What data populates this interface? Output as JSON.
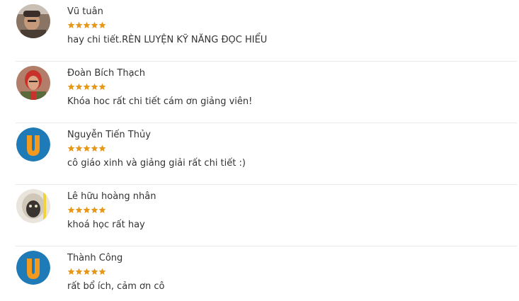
{
  "star_color": "#e59819",
  "reviews": [
    {
      "name": "Vũ tuân",
      "rating": 5,
      "text": "hay chi tiết.RÈN LUYỆN KỸ NĂNG ĐỌC HIỂU",
      "avatar": "photo"
    },
    {
      "name": "Đoàn Bích Thạch",
      "rating": 5,
      "text": "Khóa hoc rất chi tiết cám ơn giảng viên!",
      "avatar": "photo"
    },
    {
      "name": "Nguyễn Tiến Thủy",
      "rating": 5,
      "text": "cô giáo xinh và giảng giải rất chi tiết :)",
      "avatar": "letter",
      "avatar_letter": "U",
      "avatar_bg": "#1f7ab8",
      "avatar_fg": "#f39a1e"
    },
    {
      "name": "Lê hữu hoàng nhân",
      "rating": 5,
      "text": "khoá học rất hay",
      "avatar": "photo"
    },
    {
      "name": "Thành Công",
      "rating": 5,
      "text": "rất bổ ích, cảm ơn cô",
      "avatar": "letter",
      "avatar_letter": "U",
      "avatar_bg": "#1f7ab8",
      "avatar_fg": "#f39a1e"
    }
  ]
}
